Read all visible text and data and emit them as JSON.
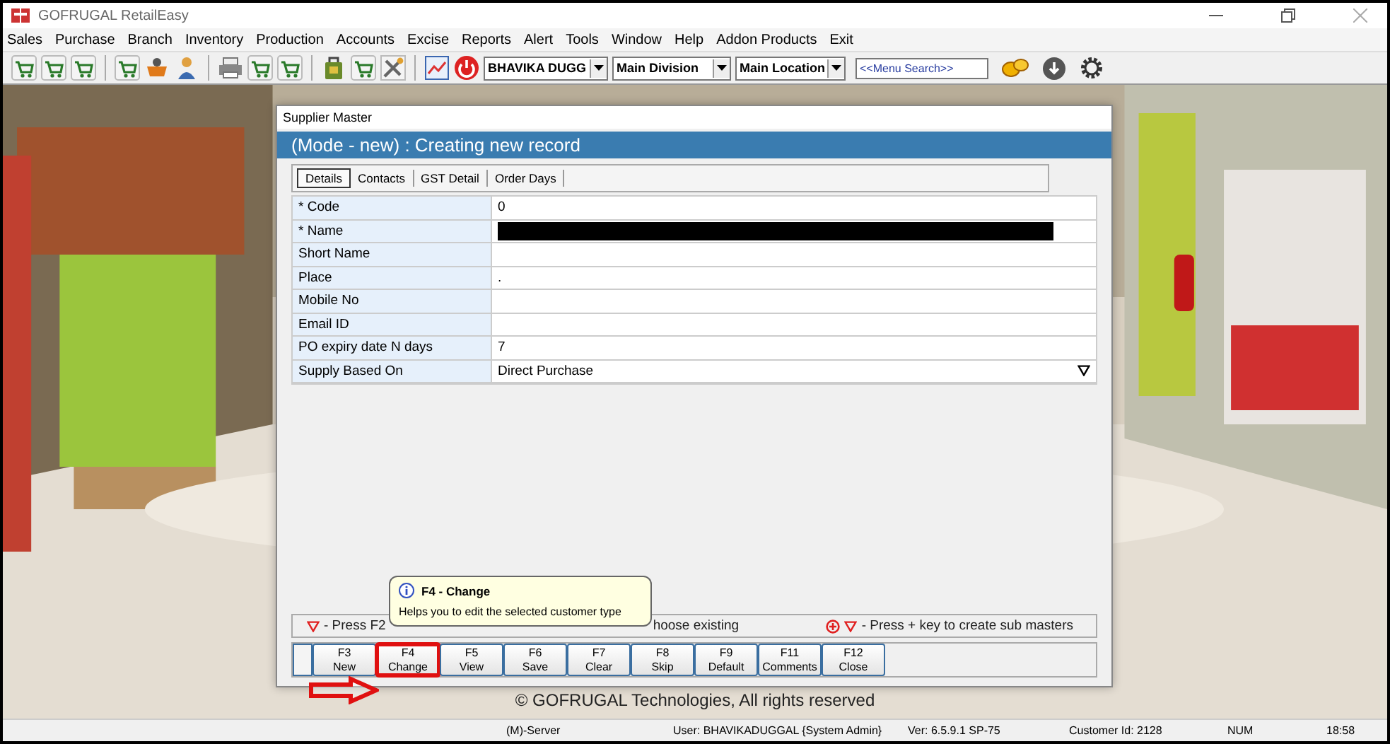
{
  "window": {
    "title": "GOFRUGAL RetailEasy"
  },
  "menu": [
    "Sales",
    "Purchase",
    "Branch",
    "Inventory",
    "Production",
    "Accounts",
    "Excise",
    "Reports",
    "Alert",
    "Tools",
    "Window",
    "Help",
    "Addon Products",
    "Exit"
  ],
  "toolbar": {
    "selectors": [
      "BHAVIKA DUGG",
      "Main Division",
      "Main Location"
    ],
    "search": {
      "placeholder": "<<Menu Search>>"
    }
  },
  "dialog": {
    "title": "Supplier Master",
    "header": "(Mode - new) : Creating new record",
    "tabs": [
      {
        "label": "Details",
        "selected": true
      },
      {
        "label": "Contacts",
        "selected": false
      },
      {
        "label": "GST Detail",
        "selected": false
      },
      {
        "label": "Order Days",
        "selected": false
      }
    ],
    "fields": [
      {
        "label": "* Code",
        "kind": "text",
        "value": "0"
      },
      {
        "label": "* Name",
        "kind": "redacted"
      },
      {
        "label": "Short Name",
        "kind": "text"
      },
      {
        "label": "Place",
        "kind": "text",
        "value": "."
      },
      {
        "label": "Mobile No",
        "kind": "text"
      },
      {
        "label": "Email ID",
        "kind": "text"
      },
      {
        "label": "PO expiry date N days",
        "kind": "text",
        "value": "7"
      },
      {
        "label": "Supply Based On",
        "kind": "dropdown",
        "value": "Direct Purchase"
      }
    ],
    "hints": [
      {
        "text": "- Press F2",
        "after": "hoose existing"
      },
      {
        "text": "- Press + key to create sub masters"
      }
    ],
    "keys": [
      {
        "key": "F3",
        "label": "New",
        "highlighted": false
      },
      {
        "key": "F4",
        "label": "Change",
        "highlighted": true
      },
      {
        "key": "F5",
        "label": "View",
        "highlighted": false
      },
      {
        "key": "F6",
        "label": "Save",
        "highlighted": false
      },
      {
        "key": "F7",
        "label": "Clear",
        "highlighted": false
      },
      {
        "key": "F8",
        "label": "Skip",
        "highlighted": false
      },
      {
        "key": "F9",
        "label": "Default",
        "highlighted": false
      },
      {
        "key": "F11",
        "label": "Comments",
        "highlighted": false
      },
      {
        "key": "F12",
        "label": "Close",
        "highlighted": false
      }
    ],
    "tooltip": {
      "title": "F4 - Change",
      "text": "Helps you to edit the selected customer type"
    }
  },
  "copyright": "© GOFRUGAL Technologies, All rights reserved",
  "status_bar": [
    "(M)-Server",
    "User: BHAVIKADUGGAL {System Admin}",
    "Ver: 6.5.9.1 SP-75",
    "Customer Id: 2128",
    "NUM",
    "18:58"
  ]
}
